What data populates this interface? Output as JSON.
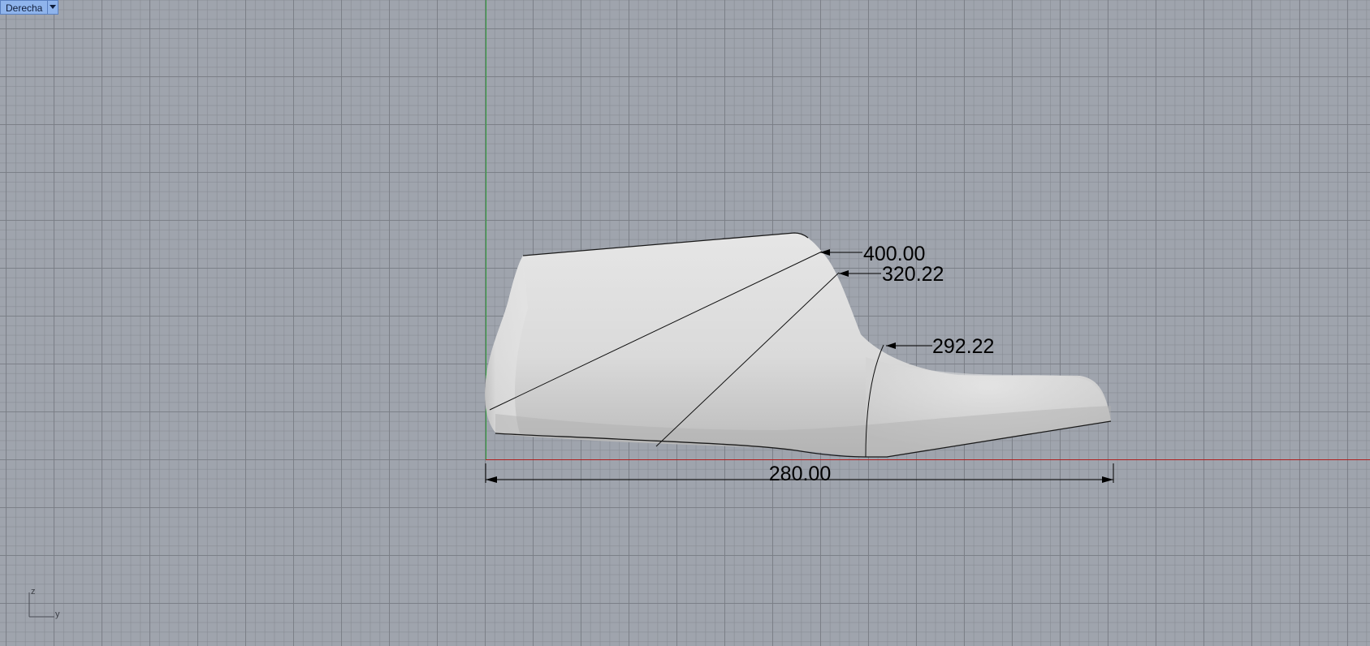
{
  "viewport": {
    "name": "Derecha",
    "menu_icon": "chevron-down-icon"
  },
  "dimensions": {
    "girth_1": "400.00",
    "girth_2": "320.22",
    "girth_3": "292.22",
    "length": "280.00"
  },
  "axis_widget": {
    "vertical_label": "z",
    "horizontal_label": "y"
  },
  "colors": {
    "background": "#9fa4ad",
    "x_axis": "#b01e1e",
    "z_axis": "#2e9e3a",
    "tab_highlight": "#8fb4ec"
  }
}
